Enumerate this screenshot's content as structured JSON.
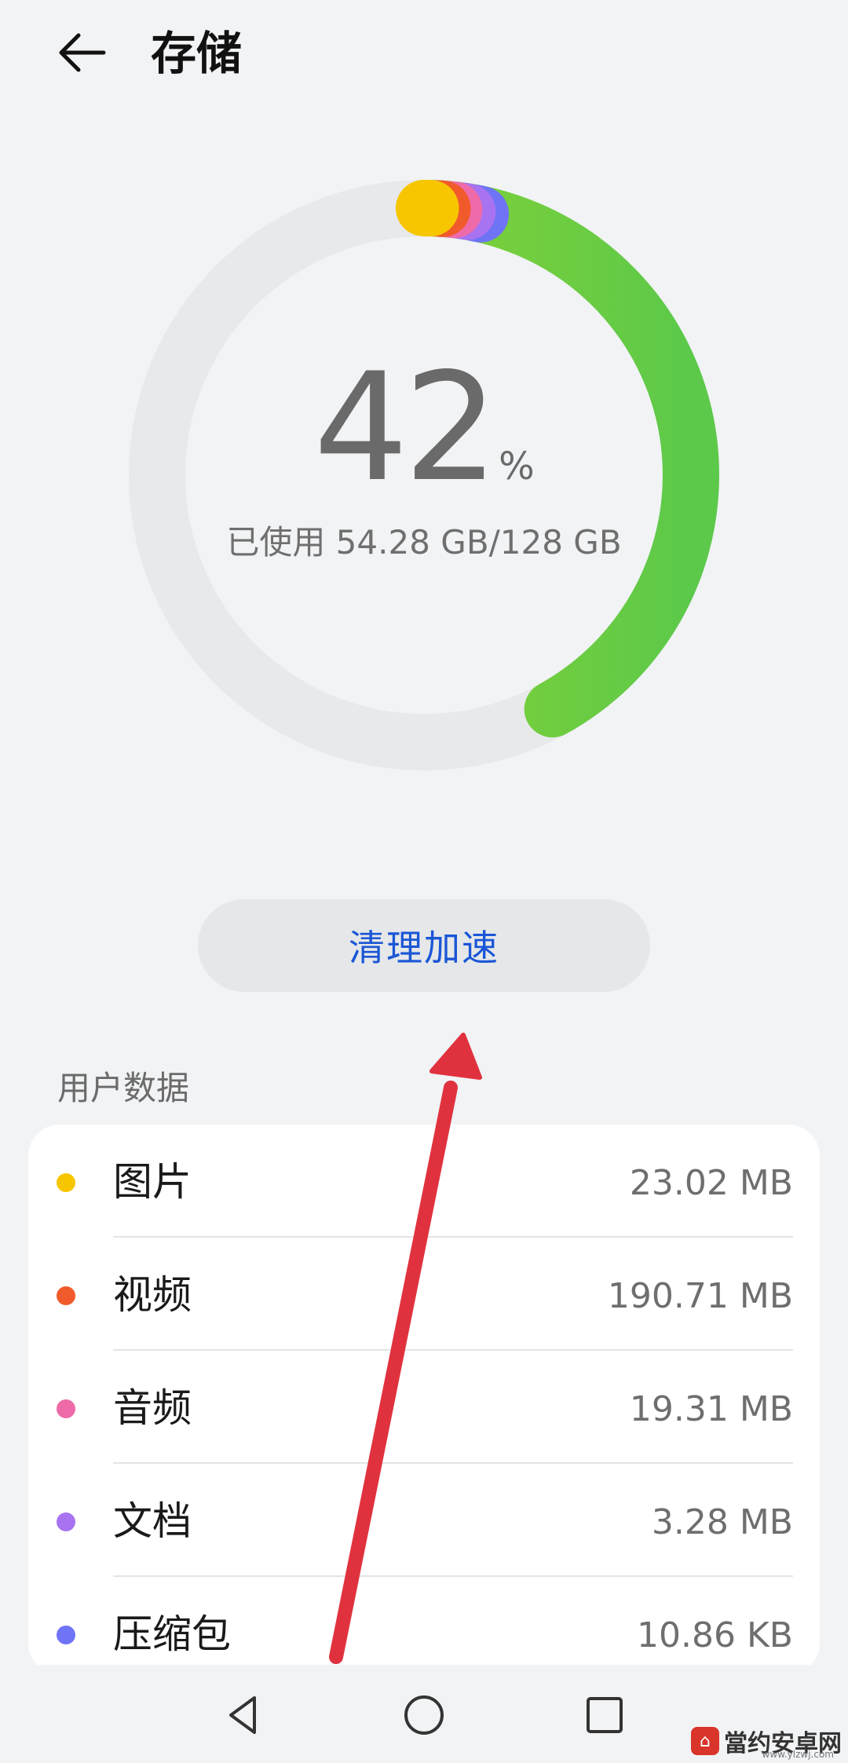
{
  "header": {
    "title": "存储",
    "back_icon": "arrow-left-icon"
  },
  "storage": {
    "percent": "42",
    "percent_sign": "%",
    "used_fraction": 0.42,
    "usage_text": "已使用 54.28 GB/128 GB",
    "segment_colors": [
      "#f7c600",
      "#f15a2b",
      "#ef6aa8",
      "#a873f0",
      "#6f73f6",
      "#9fd82a"
    ]
  },
  "actions": {
    "clean_label": "清理加速"
  },
  "user_data": {
    "title": "用户数据",
    "items": [
      {
        "label": "图片",
        "value": "23.02 MB",
        "color": "#f7c600"
      },
      {
        "label": "视频",
        "value": "190.71 MB",
        "color": "#f15a2b"
      },
      {
        "label": "音频",
        "value": "19.31 MB",
        "color": "#ef6aa8"
      },
      {
        "label": "文档",
        "value": "3.28 MB",
        "color": "#a873f0"
      },
      {
        "label": "压缩包",
        "value": "10.86 KB",
        "color": "#6f73f6"
      }
    ]
  },
  "navbar": {
    "back_icon": "triangle-back-icon",
    "home_icon": "circle-home-icon",
    "recents_icon": "square-recents-icon"
  },
  "watermark": {
    "text": "當约安卓网",
    "sub": "www.ylzwj.com"
  }
}
